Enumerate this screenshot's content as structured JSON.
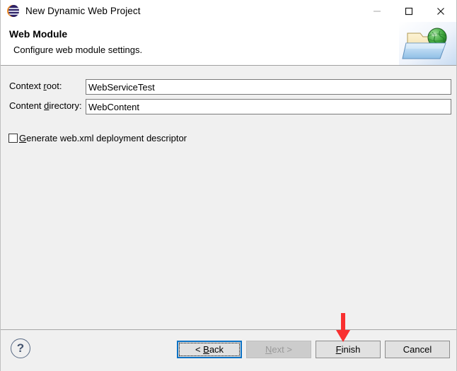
{
  "window": {
    "title": "New Dynamic Web Project",
    "icon": "eclipse-logo-icon",
    "controls": {
      "minimize": "minimize-icon",
      "maximize": "maximize-icon",
      "close": "close-icon"
    }
  },
  "header": {
    "title": "Web Module",
    "subtitle": "Configure web module settings.",
    "banner_icon": "web-folder-globe-icon"
  },
  "form": {
    "fields": [
      {
        "label_prefix": "Context ",
        "label_mnemonic": "r",
        "label_suffix": "oot:",
        "value": "WebServiceTest"
      },
      {
        "label_prefix": "Content ",
        "label_mnemonic": "d",
        "label_suffix": "irectory:",
        "value": "WebContent"
      }
    ],
    "checkbox": {
      "label_prefix": "",
      "label_mnemonic": "G",
      "label_suffix": "enerate web.xml deployment descriptor",
      "checked": false
    }
  },
  "footer": {
    "help_label": "?",
    "buttons": [
      {
        "name": "back-button",
        "prefix": "< ",
        "mnemonic": "B",
        "suffix": "ack",
        "state": "focused"
      },
      {
        "name": "next-button",
        "prefix": "",
        "mnemonic": "N",
        "suffix": "ext >",
        "state": "disabled"
      },
      {
        "name": "finish-button",
        "prefix": "",
        "mnemonic": "F",
        "suffix": "inish",
        "state": "normal"
      },
      {
        "name": "cancel-button",
        "prefix": "",
        "mnemonic": "",
        "suffix": "Cancel",
        "state": "normal"
      }
    ]
  },
  "annotation": {
    "arrow": "red-down-arrow",
    "color": "#f93030",
    "points_at": "finish-button"
  },
  "colors": {
    "dialog_bg": "#f0f0f0",
    "header_bg": "#ffffff",
    "input_bg": "#ffffff",
    "button_face": "#e1e1e1",
    "focus_blue": "#0d72c4",
    "disabled_text": "#9a9a9a",
    "annotation_red": "#f93030"
  }
}
